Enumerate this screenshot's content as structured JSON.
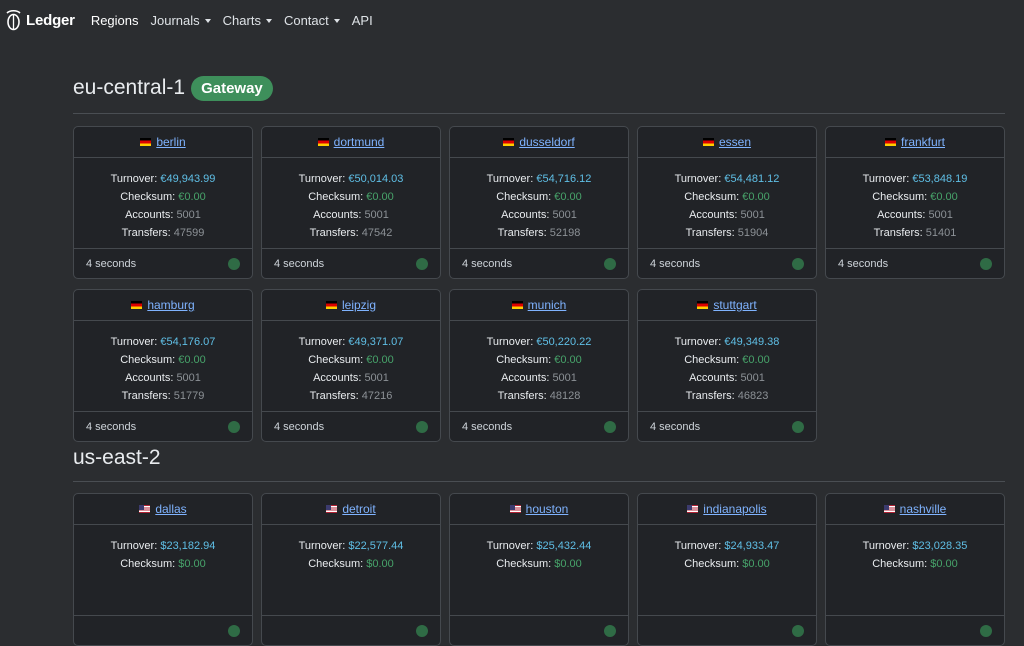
{
  "navbar": {
    "brand": "Ledger",
    "items": [
      {
        "label": "Regions",
        "active": true,
        "dropdown": false
      },
      {
        "label": "Journals",
        "active": false,
        "dropdown": true
      },
      {
        "label": "Charts",
        "active": false,
        "dropdown": true
      },
      {
        "label": "Contact",
        "active": false,
        "dropdown": true
      },
      {
        "label": "API",
        "active": false,
        "dropdown": false
      }
    ]
  },
  "labels": {
    "turnover": "Turnover:",
    "checksum": "Checksum:",
    "accounts": "Accounts:",
    "transfers": "Transfers:"
  },
  "colors": {
    "badge": "#3e8f5b",
    "link": "#7fb3ff",
    "turnover_value": "#5fbfe6",
    "checksum_value": "#47a36a",
    "status_dot": "#2f6b45"
  },
  "regions": [
    {
      "name": "eu-central-1",
      "badge": "Gateway",
      "flag": "de",
      "cards": [
        {
          "city": "berlin",
          "turnover": "€49,943.99",
          "checksum": "€0.00",
          "accounts": "5001",
          "transfers": "47599",
          "age": "4 seconds"
        },
        {
          "city": "dortmund",
          "turnover": "€50,014.03",
          "checksum": "€0.00",
          "accounts": "5001",
          "transfers": "47542",
          "age": "4 seconds"
        },
        {
          "city": "dusseldorf",
          "turnover": "€54,716.12",
          "checksum": "€0.00",
          "accounts": "5001",
          "transfers": "52198",
          "age": "4 seconds"
        },
        {
          "city": "essen",
          "turnover": "€54,481.12",
          "checksum": "€0.00",
          "accounts": "5001",
          "transfers": "51904",
          "age": "4 seconds"
        },
        {
          "city": "frankfurt",
          "turnover": "€53,848.19",
          "checksum": "€0.00",
          "accounts": "5001",
          "transfers": "51401",
          "age": "4 seconds"
        },
        {
          "city": "hamburg",
          "turnover": "€54,176.07",
          "checksum": "€0.00",
          "accounts": "5001",
          "transfers": "51779",
          "age": "4 seconds"
        },
        {
          "city": "leipzig",
          "turnover": "€49,371.07",
          "checksum": "€0.00",
          "accounts": "5001",
          "transfers": "47216",
          "age": "4 seconds"
        },
        {
          "city": "munich",
          "turnover": "€50,220.22",
          "checksum": "€0.00",
          "accounts": "5001",
          "transfers": "48128",
          "age": "4 seconds"
        },
        {
          "city": "stuttgart",
          "turnover": "€49,349.38",
          "checksum": "€0.00",
          "accounts": "5001",
          "transfers": "46823",
          "age": "4 seconds"
        }
      ]
    },
    {
      "name": "us-east-2",
      "badge": "",
      "flag": "us",
      "cards": [
        {
          "city": "dallas",
          "turnover": "$23,182.94",
          "checksum": "$0.00"
        },
        {
          "city": "detroit",
          "turnover": "$22,577.44",
          "checksum": "$0.00"
        },
        {
          "city": "houston",
          "turnover": "$25,432.44",
          "checksum": "$0.00"
        },
        {
          "city": "indianapolis",
          "turnover": "$24,933.47",
          "checksum": "$0.00"
        },
        {
          "city": "nashville",
          "turnover": "$23,028.35",
          "checksum": "$0.00"
        }
      ]
    }
  ]
}
